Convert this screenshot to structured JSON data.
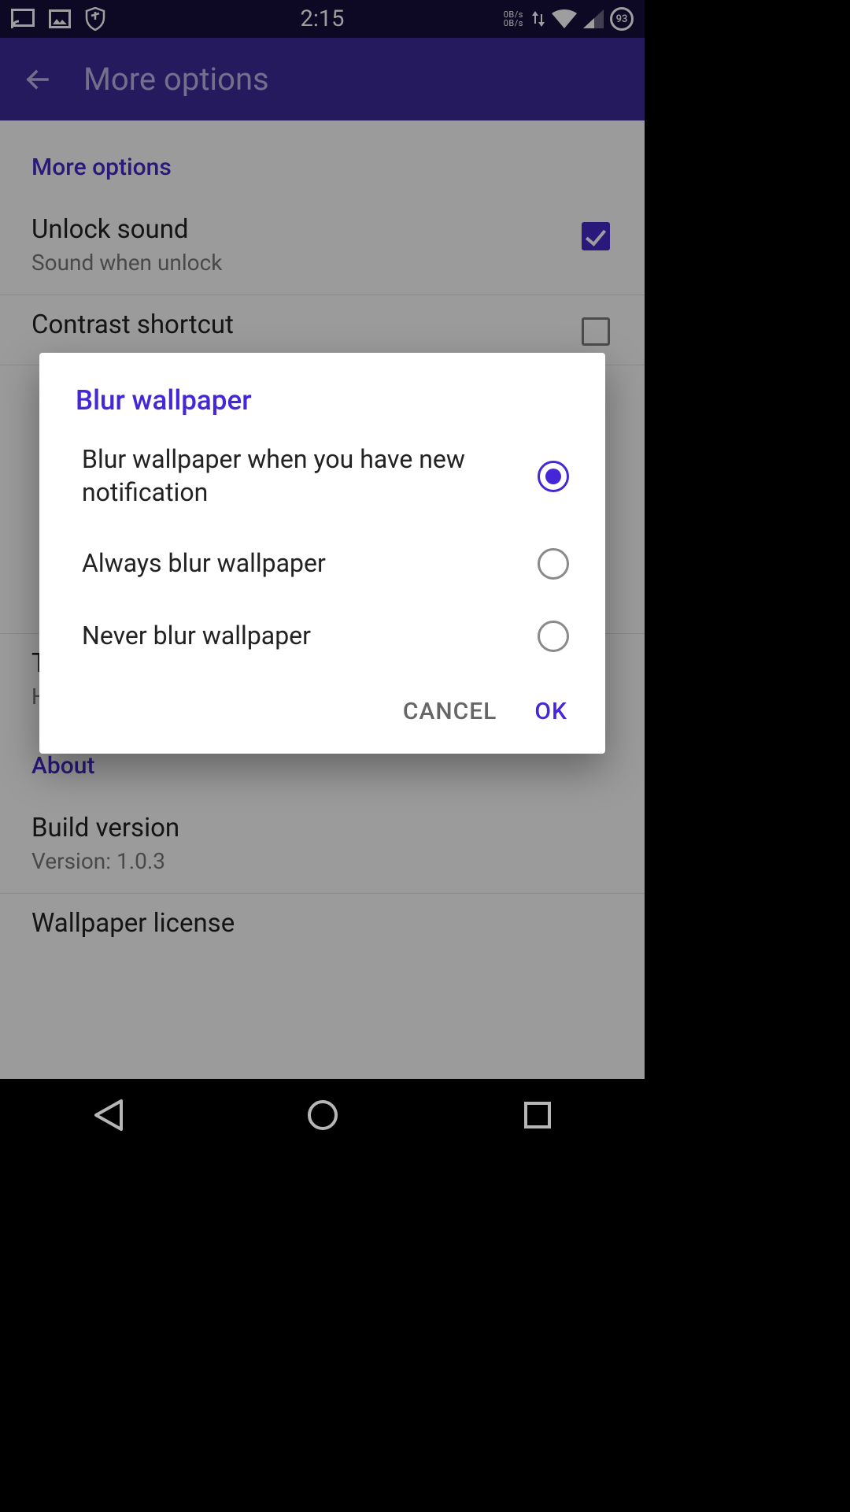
{
  "status": {
    "time": "2:15",
    "net_up": "0B/s",
    "net_down": "0B/s",
    "battery_pct": "93"
  },
  "appbar": {
    "title": "More options"
  },
  "sections": {
    "more": {
      "title": "More options",
      "unlock_title": "Unlock sound",
      "unlock_sub": "Sound when unlock",
      "contrast_title": "Contrast shortcut"
    },
    "translate_title": "Translate",
    "translate_sub": "Help us to translate to your language.",
    "about": {
      "title": "About",
      "build_title": "Build version",
      "build_sub": "Version: 1.0.3",
      "license_title": "Wallpaper license"
    }
  },
  "dialog": {
    "title": "Blur wallpaper",
    "options": {
      "0": "Blur wallpaper when you have new notification",
      "1": "Always blur wallpaper",
      "2": "Never blur wallpaper"
    },
    "selected_index": 0,
    "cancel": "CANCEL",
    "ok": "OK"
  }
}
